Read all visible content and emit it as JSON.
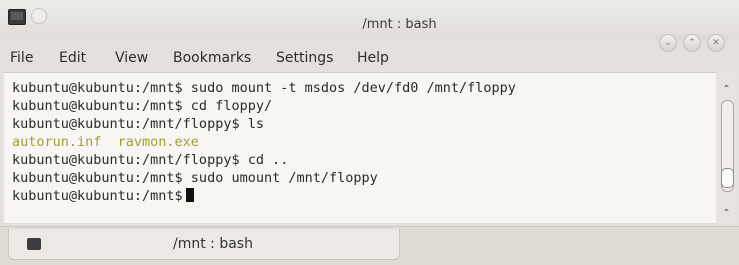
{
  "window": {
    "title": "/mnt : bash"
  },
  "menu": [
    "File",
    "Edit",
    "View",
    "Bookmarks",
    "Settings",
    "Help"
  ],
  "window_buttons": {
    "minimize_icon": "chevron-down-icon",
    "maximize_icon": "chevron-up-icon",
    "close_icon": "close-icon"
  },
  "terminal": {
    "lines": [
      "kubuntu@kubuntu:/mnt$ sudo mount -t msdos /dev/fd0 /mnt/floppy",
      "kubuntu@kubuntu:/mnt$ cd floppy/",
      "kubuntu@kubuntu:/mnt/floppy$ ls",
      "autorun.inf  ravmon.exe",
      "kubuntu@kubuntu:/mnt/floppy$ cd ..",
      "kubuntu@kubuntu:/mnt$ sudo umount /mnt/floppy",
      "kubuntu@kubuntu:/mnt$"
    ],
    "ls_output_color": "#9ca234"
  },
  "tab": {
    "label": "/mnt : bash"
  }
}
